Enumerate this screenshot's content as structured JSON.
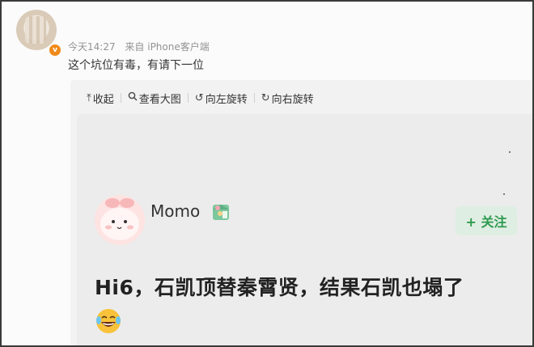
{
  "post": {
    "time": "今天14:27",
    "source": "来自 iPhone客户端",
    "text": "这个坑位有毒，有请下一位"
  },
  "toolbar": {
    "collapse": "收起",
    "view_large": "查看大图",
    "rotate_left": "向左旋转",
    "rotate_right": "向右旋转"
  },
  "image": {
    "username": "Momo",
    "follow_label": "+ 关注",
    "headline": "Hi6，石凯顶替秦霄贤，结果石凯也塌了"
  },
  "colors": {
    "follow_bg": "#dfeee3",
    "follow_text": "#2e9a4e",
    "vip_badge": "#f08a1b"
  }
}
